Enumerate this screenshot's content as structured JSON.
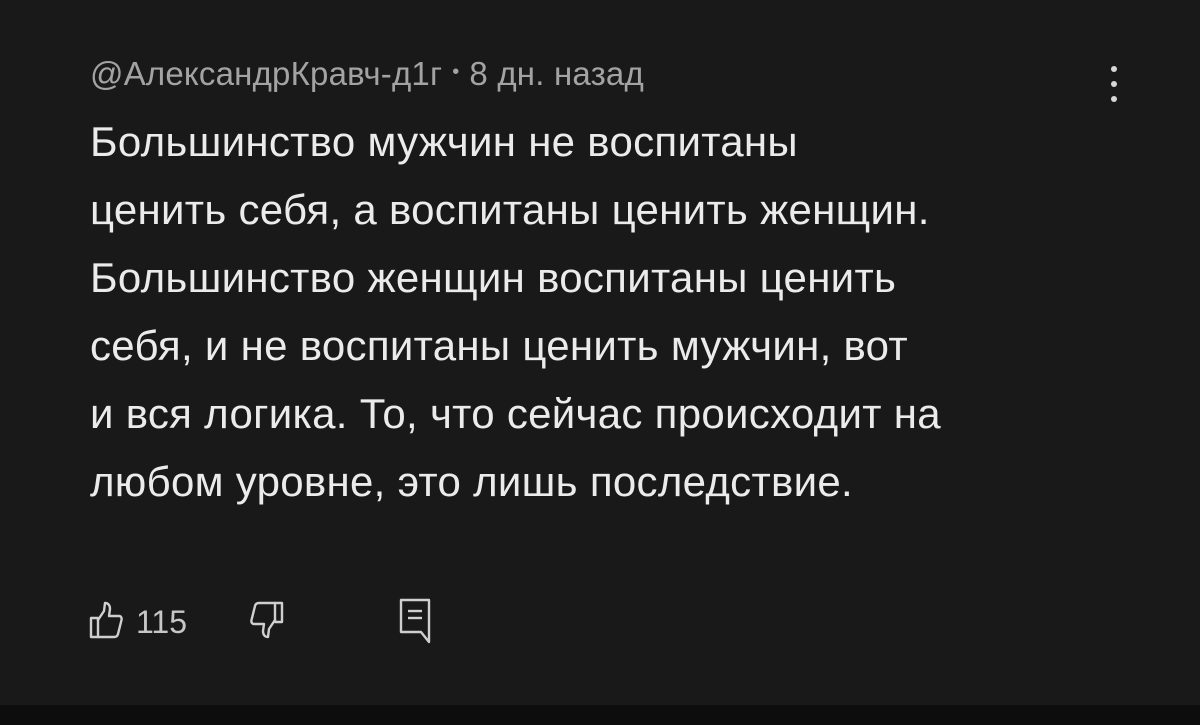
{
  "comment": {
    "author": "@АлександрКравч-д1г",
    "separator": "•",
    "time": "8 дн. назад",
    "text_lines": [
      "Большинство мужчин не воспитаны",
      "ценить себя, а воспитаны ценить женщин.",
      "Большинство женщин воспитаны ценить",
      "себя, и не воспитаны ценить мужчин, вот",
      "и вся логика. То, что сейчас происходит на",
      "любом уровне, это лишь последствие."
    ],
    "likes": "115"
  },
  "icons": {
    "like": "thumbs-up-icon",
    "dislike": "thumbs-down-icon",
    "reply": "reply-comment-icon",
    "menu": "more-vertical-icon"
  }
}
